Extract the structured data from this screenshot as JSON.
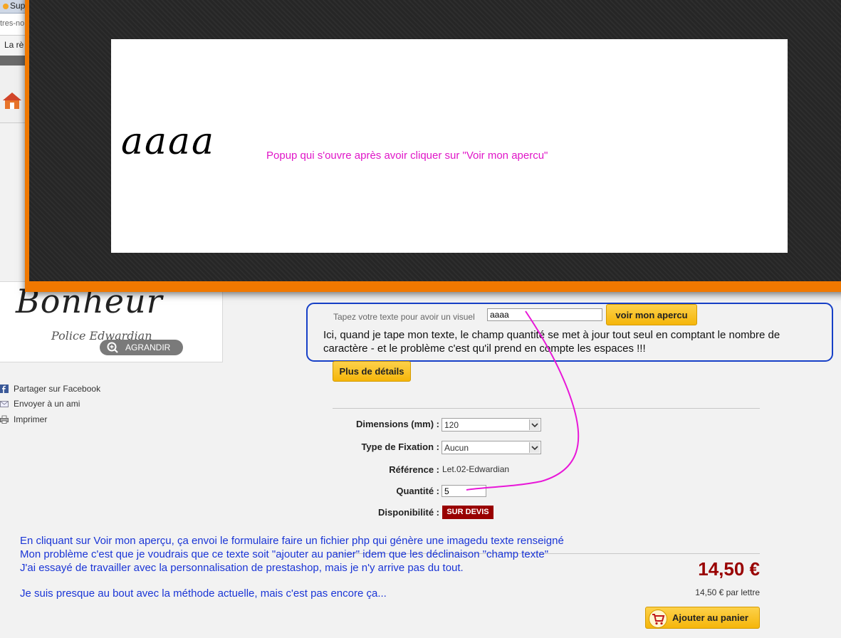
{
  "browser": {
    "tab_title": "Sup",
    "url_fragment": "tres-no",
    "bookmark_text": "La rè"
  },
  "product_image": {
    "word": "Bonheur",
    "font_caption": "Police Edwardian",
    "zoom_label": "AGRANDIR"
  },
  "share": {
    "facebook": "Partager sur Facebook",
    "email": "Envoyer à un ami",
    "print": "Imprimer"
  },
  "custom_text": {
    "label": "Tapez votre texte pour avoir un visuel",
    "value": "aaaa",
    "preview_button": "voir mon apercu",
    "annotation": "Ici, quand je tape mon texte, le champ quantité se met à jour tout seul en comptant le nombre de caractère - et le problème c'est qu'il prend en compte les espaces  !!!"
  },
  "details_button": "Plus de détails",
  "attributes": {
    "dimensions_label": "Dimensions (mm) :",
    "dimensions_value": "120",
    "fixation_label": "Type de Fixation :",
    "fixation_value": "Aucun",
    "reference_label": "Référence :",
    "reference_value": "Let.02-Edwardian",
    "quantity_label": "Quantité :",
    "quantity_value": "5",
    "availability_label": "Disponibilité :",
    "availability_value": "SUR DEVIS"
  },
  "notes": [
    "En cliquant sur Voir mon aperçu, ça envoi le formulaire faire un fichier php qui génère une imagedu texte renseigné",
    "Mon problème c'est que je voudrais que ce texte soit \"ajouter au panier\" idem que les déclinaison \"champ texte\"",
    "J'ai essayé de travailler avec la personnalisation de prestashop, mais je n'y arrive pas du tout.",
    "Je suis presque au bout avec la méthode actuelle, mais c'est pas encore ça..."
  ],
  "price": {
    "amount": "14,50 €",
    "unit": "14,50 € par lettre"
  },
  "cart_button": "Ajouter au panier",
  "popup": {
    "preview_text": "aaaa",
    "note": "Popup qui s'ouvre après avoir cliquer sur \"Voir mon apercu\""
  },
  "colors": {
    "popup_border": "#f07800",
    "annotation_blue": "#1740c7",
    "annotation_magenta": "#e017c8",
    "price_red": "#990000",
    "button_yellow": "#f5b60a"
  }
}
